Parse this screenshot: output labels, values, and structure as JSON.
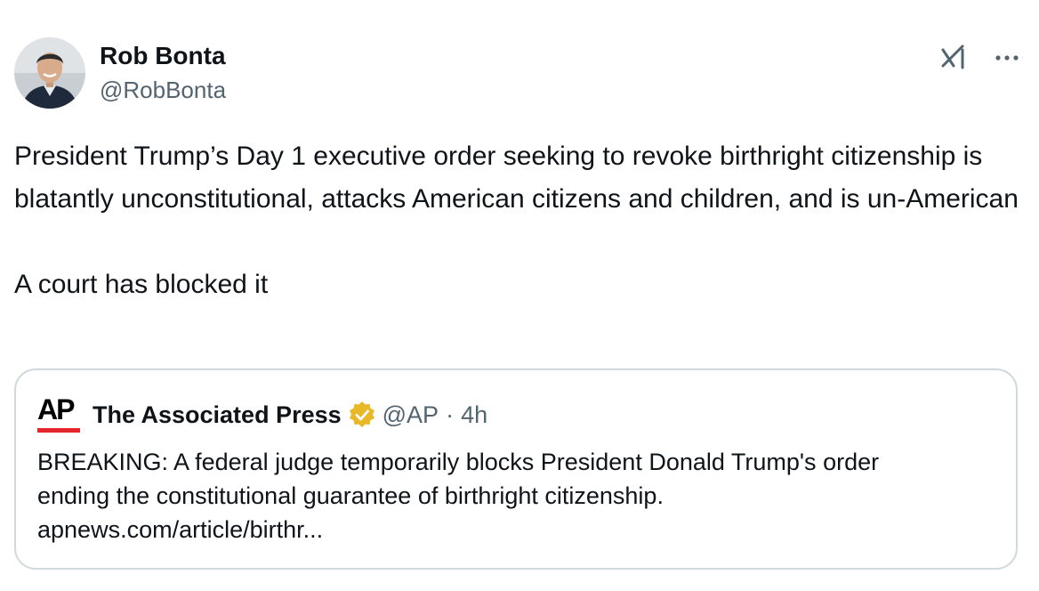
{
  "author": {
    "display_name": "Rob Bonta",
    "handle": "@RobBonta"
  },
  "tweet": {
    "text": "President Trump’s Day 1 executive order seeking to revoke birthright citizenship is blatantly unconstitutional, attacks American citizens and children, and is un-American\n\nA court has blocked it"
  },
  "quoted": {
    "logo_text": "AP",
    "display_name": "The Associated Press",
    "handle": "@AP",
    "separator": "·",
    "time": "4h",
    "text_line1": "BREAKING: A federal judge temporarily blocks President Donald Trump's order",
    "text_line2": "ending the constitutional guarantee of birthright citizenship.",
    "link": "apnews.com/article/birthr..."
  },
  "icons": [
    "grok-icon",
    "more-icon",
    "verified-badge-icon"
  ],
  "colors": {
    "text": "#0f1419",
    "secondary": "#536471",
    "border": "#cfd9de",
    "verified_gold": "#e8b829",
    "ap_red": "#e4252c"
  }
}
